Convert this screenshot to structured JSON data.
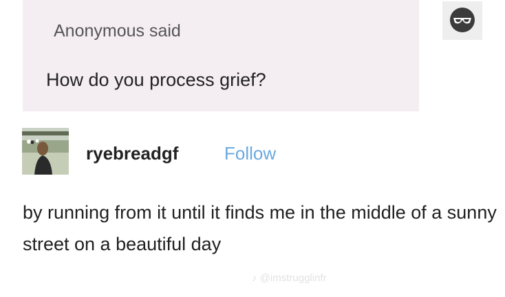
{
  "ask": {
    "asker": "Anonymous said",
    "question": "How do you process grief?",
    "avatar_icon": "anonymous-sunglasses-icon"
  },
  "post": {
    "username": "ryebreadgf",
    "follow_label": "Follow",
    "avatar_icon": "user-photo-avatar",
    "answer": "by running from it until it finds me in the middle of a sunny street on a beautiful day"
  },
  "watermark": {
    "text": "♪ @imstrugglinfr",
    "icon": "tiktok-note-icon"
  },
  "colors": {
    "ask_background": "#f4edf1",
    "follow_link": "#6aa9df",
    "text": "#222222"
  }
}
